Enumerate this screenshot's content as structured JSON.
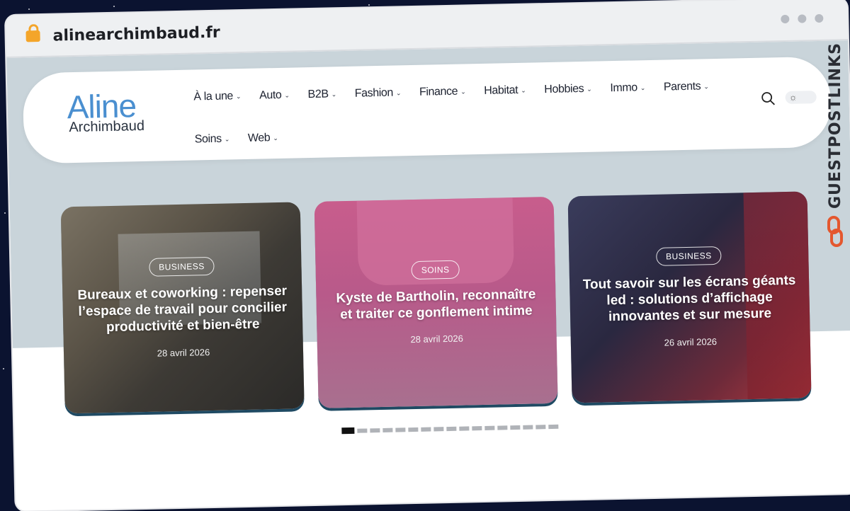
{
  "browser": {
    "url": "alinearchimbaud.fr"
  },
  "logo": {
    "line1": "Aline",
    "line2": "Archimbaud"
  },
  "nav": {
    "items": [
      {
        "label": "À la une"
      },
      {
        "label": "Auto"
      },
      {
        "label": "B2B"
      },
      {
        "label": "Fashion"
      },
      {
        "label": "Finance"
      },
      {
        "label": "Habitat"
      },
      {
        "label": "Hobbies"
      },
      {
        "label": "Immo"
      },
      {
        "label": "Parents"
      },
      {
        "label": "Soins"
      },
      {
        "label": "Web"
      }
    ]
  },
  "cards": [
    {
      "category": "BUSINESS",
      "title": "Bureaux et coworking : repenser l’espace de travail pour concilier productivité et bien-être",
      "date": "28 avril 2026"
    },
    {
      "category": "SOINS",
      "title": "Kyste de Bartholin, reconnaître et traiter ce gonflement intime",
      "date": "28 avril 2026"
    },
    {
      "category": "BUSINESS",
      "title": "Tout savoir sur les écrans géants led : solutions d’affichage innovantes et sur mesure",
      "date": "26 avril 2026"
    }
  ],
  "pager": {
    "total": 17,
    "active_index": 0
  },
  "side_brand": {
    "text": "GUESTPOSTLINKS"
  },
  "colors": {
    "accent": "#4a8fd0",
    "hero_bg": "#c9d4da",
    "lock": "#f4a52a",
    "brand_orange": "#e4572e"
  }
}
